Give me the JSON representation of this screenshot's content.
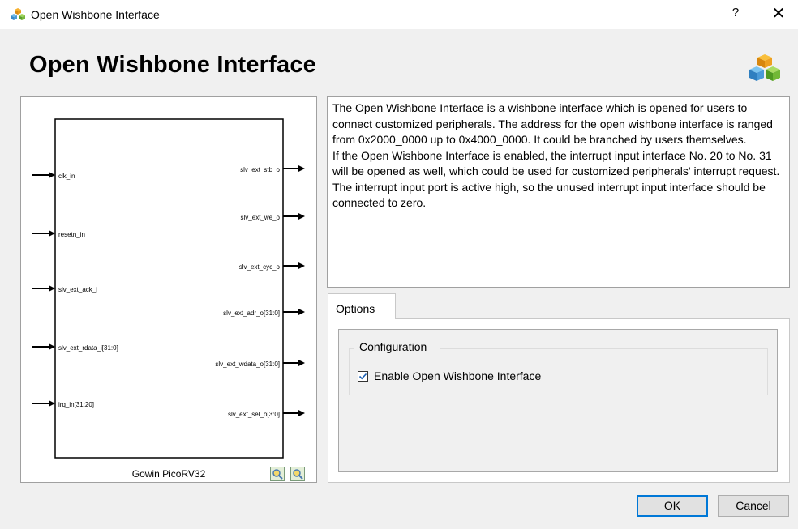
{
  "window": {
    "title": "Open Wishbone Interface",
    "help_label": "?",
    "close_label": "✕",
    "app_icon": "cubes-icon"
  },
  "header": {
    "heading": "Open Wishbone Interface",
    "icon": "cubes-icon"
  },
  "diagram": {
    "block_name": "Gowin PicoRV32",
    "inputs": [
      "clk_in",
      "resetn_in",
      "slv_ext_ack_i",
      "slv_ext_rdata_i[31:0]",
      "irq_in[31:20]"
    ],
    "outputs": [
      "slv_ext_stb_o",
      "slv_ext_we_o",
      "slv_ext_cyc_o",
      "slv_ext_adr_o[31:0]",
      "slv_ext_wdata_o[31:0]",
      "slv_ext_sel_o[3:0]"
    ],
    "zoom_in_icon": "zoom-in-icon",
    "zoom_out_icon": "zoom-out-icon"
  },
  "description": {
    "paragraphs": [
      "The Open Wishbone Interface is a wishbone interface which is opened for users to connect customized peripherals. The address for the open wishbone interface is ranged from 0x2000_0000 up to 0x4000_0000. It could be branched by users themselves.",
      "If the Open Wishbone Interface is enabled, the interrupt input interface No. 20 to No. 31 will be opened as well, which could be used for customized peripherals' interrupt request. The interrupt input port is active high, so the unused interrupt input interface should be connected to zero."
    ]
  },
  "options": {
    "tab_label": "Options",
    "group_label": "Configuration",
    "checkbox_label": "Enable Open Wishbone Interface",
    "checkbox_checked": true
  },
  "buttons": {
    "ok": "OK",
    "cancel": "Cancel"
  }
}
